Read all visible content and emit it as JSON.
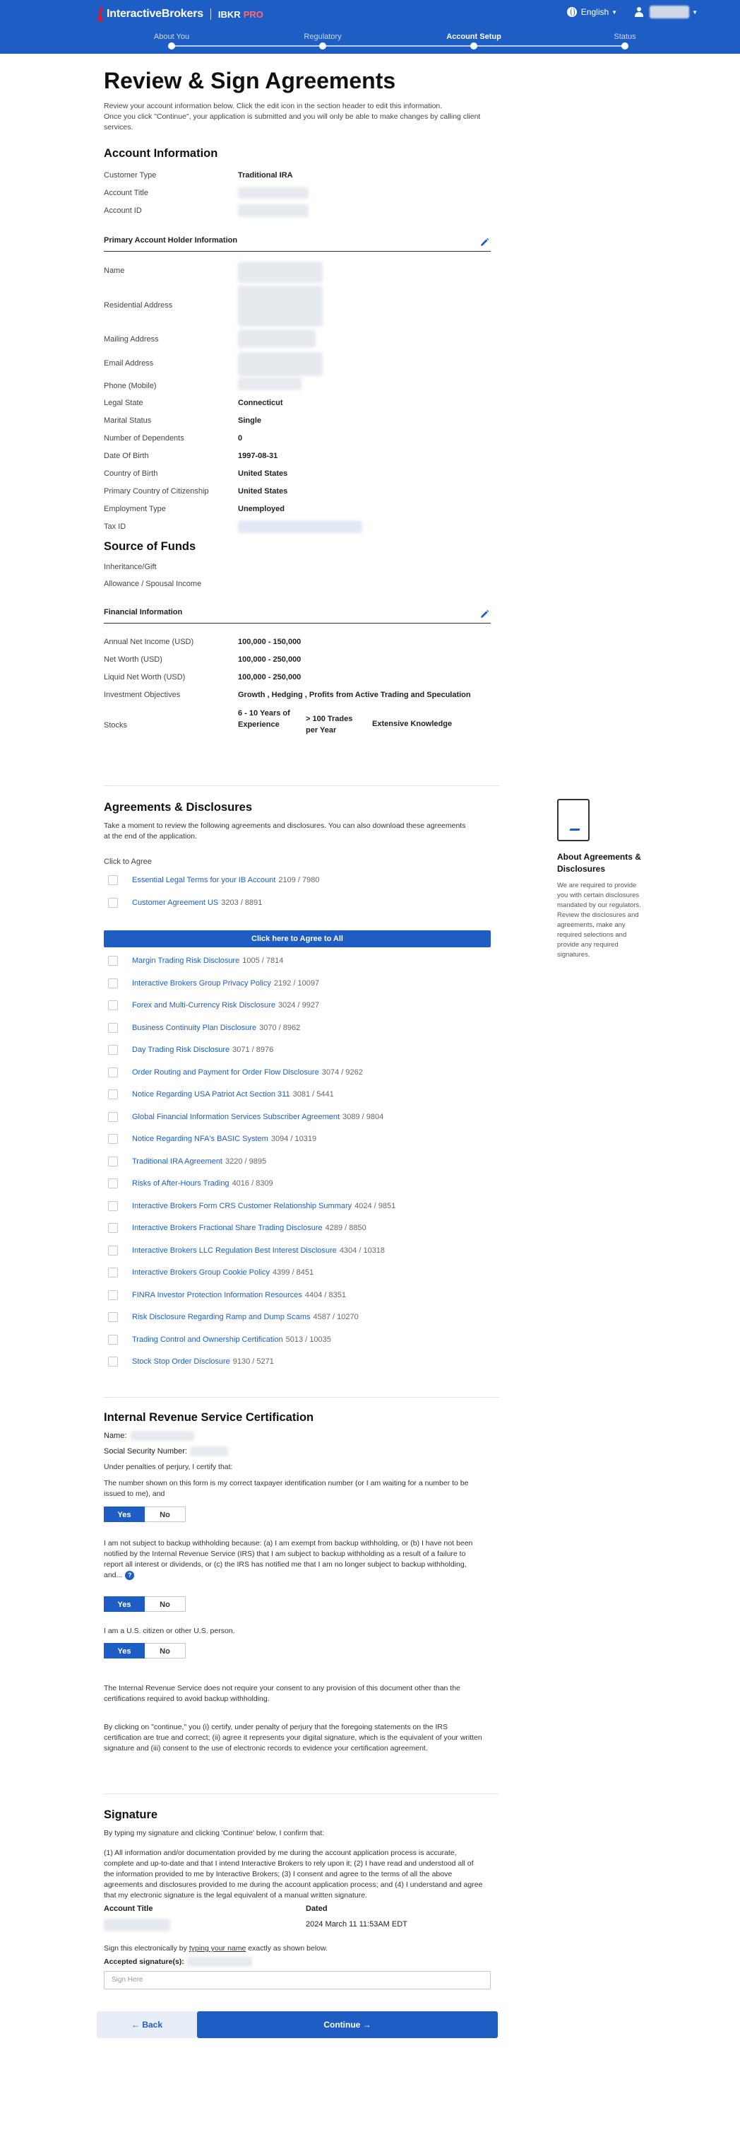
{
  "header": {
    "brand": "InteractiveBrokers",
    "product": "IBKR",
    "product_tier": "PRO",
    "language": "English"
  },
  "steps": [
    {
      "label": "About You",
      "active": false
    },
    {
      "label": "Regulatory",
      "active": false
    },
    {
      "label": "Account Setup",
      "active": true
    },
    {
      "label": "Status",
      "active": false
    }
  ],
  "page": {
    "title": "Review & Sign Agreements",
    "intro_line1": "Review your account information below. Click the edit icon in the section header to edit this information.",
    "intro_line2": "Once you click \"Continue\", your application is submitted and you will only be able to make changes by calling client services."
  },
  "account_info": {
    "heading": "Account Information",
    "customer_type_label": "Customer Type",
    "customer_type": "Traditional IRA",
    "account_title_label": "Account Title",
    "account_id_label": "Account ID"
  },
  "primary_holder": {
    "heading": "Primary Account Holder Information",
    "name_label": "Name",
    "residential_label": "Residential Address",
    "mailing_label": "Mailing Address",
    "email_label": "Email Address",
    "phone_label": "Phone (Mobile)",
    "legal_state_label": "Legal State",
    "legal_state": "Connecticut",
    "marital_label": "Marital Status",
    "marital": "Single",
    "dependents_label": "Number of Dependents",
    "dependents": "0",
    "dob_label": "Date Of Birth",
    "dob": "1997-08-31",
    "country_birth_label": "Country of Birth",
    "country_birth": "United States",
    "citizenship_label": "Primary Country of Citizenship",
    "citizenship": "United States",
    "employment_label": "Employment Type",
    "employment": "Unemployed",
    "tax_id_label": "Tax ID"
  },
  "source_of_funds": {
    "heading": "Source of Funds",
    "items": [
      "Inheritance/Gift",
      "Allowance / Spousal Income"
    ]
  },
  "financial": {
    "heading": "Financial Information",
    "annual_income_label": "Annual Net Income (USD)",
    "annual_income": "100,000 - 150,000",
    "net_worth_label": "Net Worth (USD)",
    "net_worth": "100,000 - 250,000",
    "liquid_label": "Liquid Net Worth (USD)",
    "liquid": "100,000 - 250,000",
    "objectives_label": "Investment Objectives",
    "objectives": "Growth , Hedging , Profits from Active Trading and Speculation",
    "stocks_label": "Stocks",
    "stocks_years": "6 - 10 Years of Experience",
    "stocks_trades": "> 100 Trades per Year",
    "stocks_knowledge": "Extensive Knowledge"
  },
  "agreements": {
    "heading": "Agreements & Disclosures",
    "intro": "Take a moment to review the following agreements and disclosures. You can also download these agreements at the end of the application.",
    "click_to_agree": "Click to Agree",
    "agree_all": "Click here to Agree to All",
    "top_items": [
      {
        "title": "Essential Legal Terms for your IB Account",
        "code": "2109 / 7980"
      },
      {
        "title": "Customer Agreement US",
        "code": "3203 / 8891"
      }
    ],
    "items": [
      {
        "title": "Margin Trading Risk Disclosure",
        "code": "1005 / 7814"
      },
      {
        "title": "Interactive Brokers Group Privacy Policy",
        "code": "2192 / 10097"
      },
      {
        "title": "Forex and Multi-Currency Risk Disclosure",
        "code": "3024 / 9927"
      },
      {
        "title": "Business Continuity Plan Disclosure",
        "code": "3070 / 8962"
      },
      {
        "title": "Day Trading Risk Disclosure",
        "code": "3071 / 8976"
      },
      {
        "title": "Order Routing and Payment for Order Flow Disclosure",
        "code": "3074 / 9262"
      },
      {
        "title": "Notice Regarding USA Patriot Act Section 311",
        "code": "3081 / 5441"
      },
      {
        "title": "Global Financial Information Services Subscriber Agreement",
        "code": "3089 / 9804"
      },
      {
        "title": "Notice Regarding NFA's BASIC System",
        "code": "3094 / 10319"
      },
      {
        "title": "Traditional IRA Agreement",
        "code": "3220 / 9895"
      },
      {
        "title": "Risks of After-Hours Trading",
        "code": "4016 / 8309"
      },
      {
        "title": "Interactive Brokers Form CRS Customer Relationship Summary",
        "code": "4024 / 9851"
      },
      {
        "title": "Interactive Brokers Fractional Share Trading Disclosure",
        "code": "4289 / 8850"
      },
      {
        "title": "Interactive Brokers LLC Regulation Best Interest Disclosure",
        "code": "4304 / 10318"
      },
      {
        "title": "Interactive Brokers Group Cookie Policy",
        "code": "4399 / 8451"
      },
      {
        "title": "FINRA Investor Protection Information Resources",
        "code": "4404 / 8351"
      },
      {
        "title": "Risk Disclosure Regarding Ramp and Dump Scams",
        "code": "4587 / 10270"
      },
      {
        "title": "Trading Control and Ownership Certification",
        "code": "5013 / 10035"
      },
      {
        "title": "Stock Stop Order Disclosure",
        "code": "9130 / 5271"
      }
    ]
  },
  "sidebar": {
    "title": "About Agreements & Disclosures",
    "text": "We are required to provide you with certain disclosures mandated by our regulators. Review the disclosures and agreements, make any required selections and provide any required signatures."
  },
  "irs": {
    "heading": "Internal Revenue Service Certification",
    "name_label": "Name:",
    "ssn_label": "Social Security Number:",
    "perjury": "Under penalties of perjury, I certify that:",
    "q1": "The number shown on this form is my correct taxpayer identification number (or I am waiting for a number to be issued to me), and",
    "q2": "I am not subject to backup withholding because: (a) I am exempt from backup withholding, or (b) I have not been notified by the Internal Revenue Service (IRS) that I am subject to backup withholding as a result of a failure to report all interest or dividends, or (c) the IRS has notified me that I am no longer subject to backup withholding, and...",
    "q3": "I am a U.S. citizen or other U.S. person.",
    "yes": "Yes",
    "no": "No",
    "consent": "The Internal Revenue Service does not require your consent to any provision of this document other than the certifications required to avoid backup withholding.",
    "continue_text": "By clicking on \"continue,\" you (i) certify, under penalty of perjury that the foregoing statements on the IRS certification are true and correct; (ii) agree it represents your digital signature, which is the equivalent of your written signature and (iii) consent to the use of electronic records to evidence your certification agreement."
  },
  "signature": {
    "heading": "Signature",
    "intro": "By typing my signature and clicking 'Continue' below, I confirm that:",
    "terms": "(1) All information and/or documentation provided by me during the account application process is accurate, complete and up-to-date and that I intend Interactive Brokers to rely upon it; (2) I have read and understood all of the information provided to me by Interactive Brokers; (3) I consent and agree to the terms of all the above agreements and disclosures provided to me during the account application process; and (4) I understand and agree that my electronic signature is the legal equivalent of a manual written signature.",
    "account_title_label": "Account Title",
    "dated_label": "Dated",
    "dated": "2024 March 11 11:53AM EDT",
    "sign_instr_pre": "Sign this electronically by ",
    "sign_instr_link": "typing your name",
    "sign_instr_post": " exactly as shown below.",
    "accepted_label": "Accepted signature(s):",
    "placeholder": "Sign Here"
  },
  "footer": {
    "back": "Back",
    "continue": "Continue"
  },
  "colors": {
    "primary": "#1e5ec4",
    "logo_red": "#d81e2c"
  }
}
